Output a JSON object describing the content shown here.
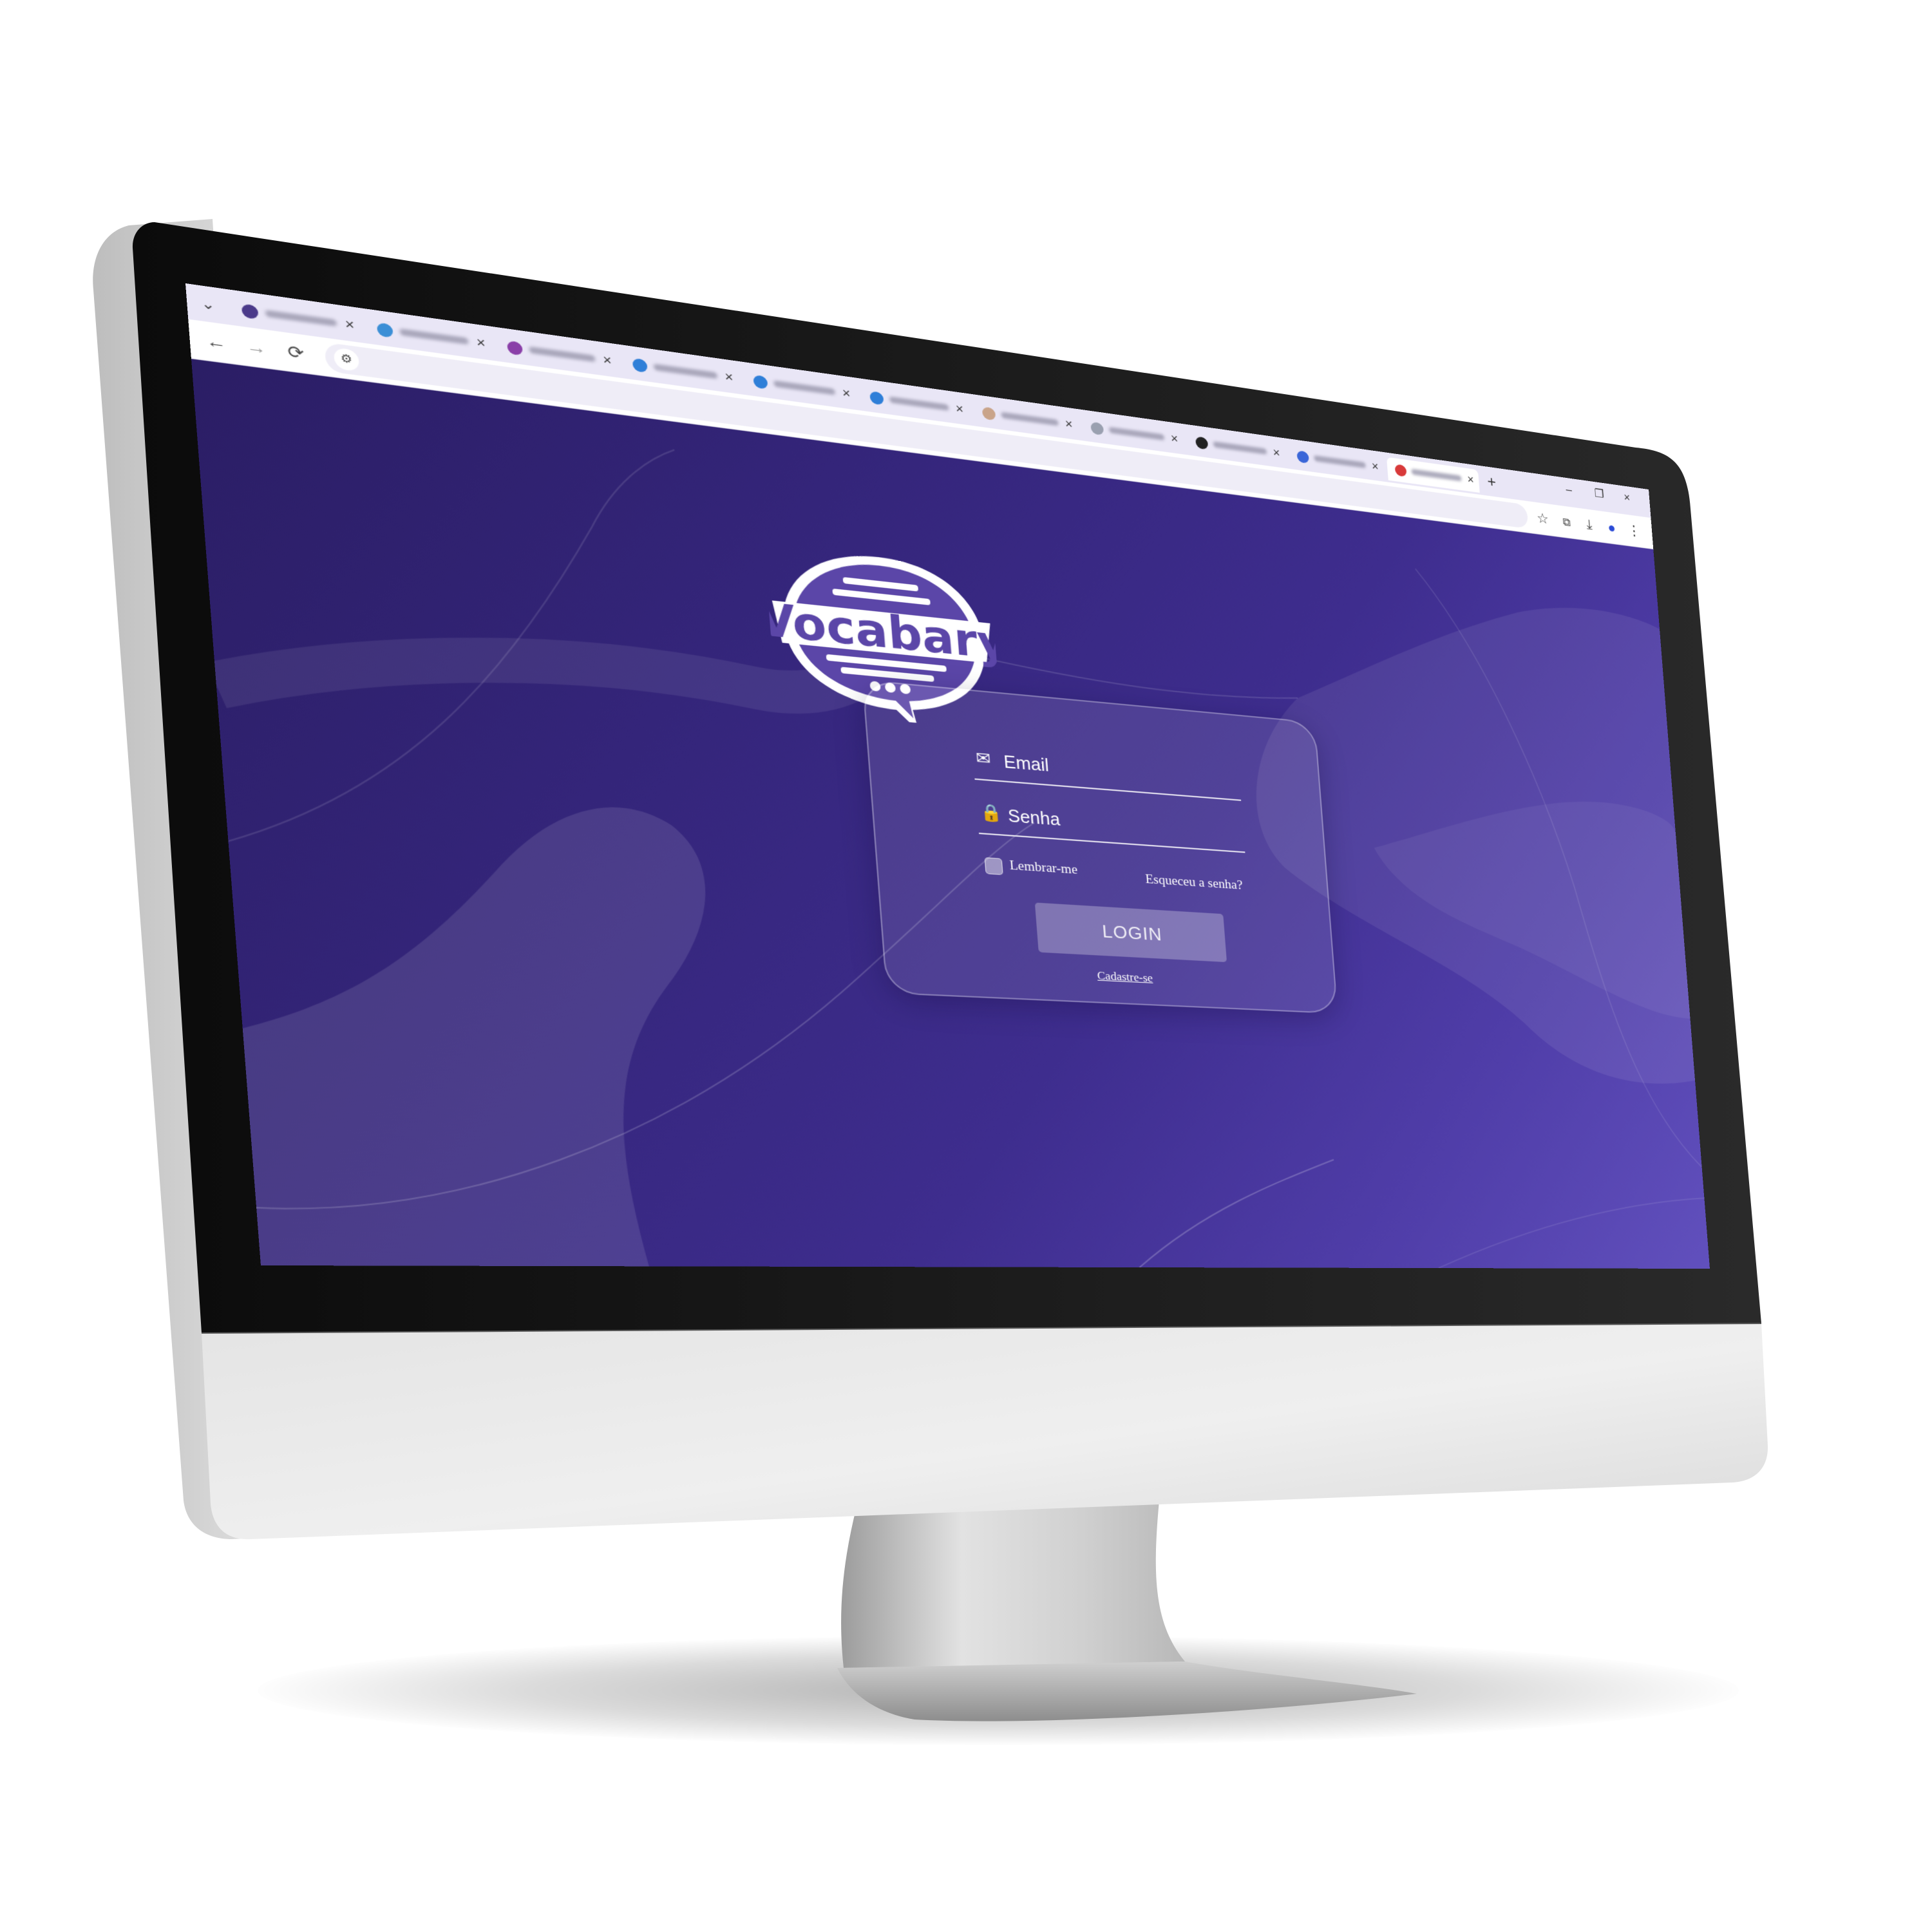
{
  "browser": {
    "tabs": [
      {
        "favicon_color": "#4b3a8a",
        "active": false
      },
      {
        "favicon_color": "#3b8fd6",
        "active": false
      },
      {
        "favicon_color": "#8a3fa8",
        "active": false
      },
      {
        "favicon_color": "#2f7fd8",
        "active": false
      },
      {
        "favicon_color": "#2f7fd8",
        "active": false
      },
      {
        "favicon_color": "#2f7fd8",
        "active": false
      },
      {
        "favicon_color": "#c9a48a",
        "active": false
      },
      {
        "favicon_color": "#9aa0b0",
        "active": false
      },
      {
        "favicon_color": "#222222",
        "active": false
      },
      {
        "favicon_color": "#3a66d8",
        "active": false
      },
      {
        "favicon_color": "#d83a3a",
        "active": true
      }
    ],
    "tab_close": "×",
    "new_tab": "+",
    "minimize": "–",
    "restore": "❐",
    "close": "×",
    "nav": {
      "back": "←",
      "forward": "→",
      "reload": "⟳"
    },
    "address_value": "",
    "toolbar_icons": [
      "star-icon",
      "extensions-icon",
      "download-icon",
      "profile-icon",
      "menu-icon"
    ]
  },
  "app": {
    "logo_text": "Vocabary",
    "email_placeholder": "Email",
    "password_placeholder": "Senha",
    "remember_label": "Lembrar-me",
    "forgot_label": "Esqueceu a senha?",
    "login_button": "LOGIN",
    "signup_label": "Cadastre-se"
  },
  "colors": {
    "bg_dark": "#2a1d63",
    "bg_light": "#6150bd",
    "logo_purple": "#5b46a8",
    "accent": "#ffffff"
  }
}
